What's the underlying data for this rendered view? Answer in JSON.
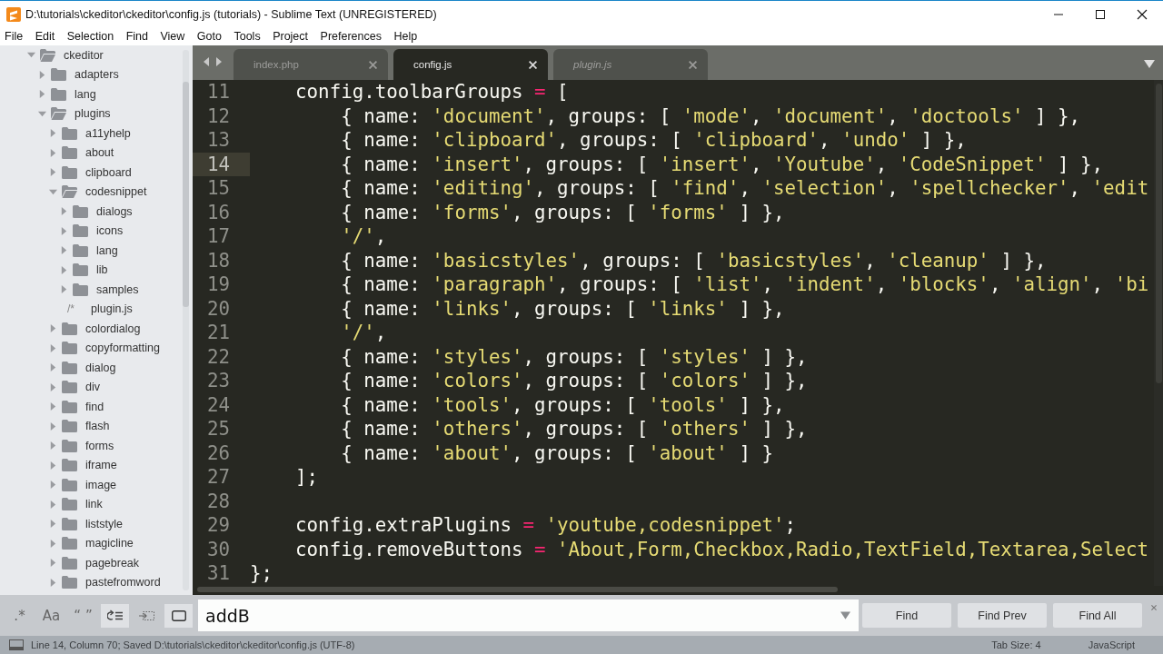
{
  "window": {
    "title": "D:\\tutorials\\ckeditor\\ckeditor\\config.js (tutorials) - Sublime Text (UNREGISTERED)"
  },
  "menu": [
    "File",
    "Edit",
    "Selection",
    "Find",
    "View",
    "Goto",
    "Tools",
    "Project",
    "Preferences",
    "Help"
  ],
  "sidebar": {
    "items": [
      {
        "kind": "folder",
        "name": "ckeditor",
        "expanded": true,
        "children": [
          {
            "kind": "folder",
            "name": "adapters",
            "expanded": false
          },
          {
            "kind": "folder",
            "name": "lang",
            "expanded": false
          },
          {
            "kind": "folder",
            "name": "plugins",
            "expanded": true,
            "children": [
              {
                "kind": "folder",
                "name": "a11yhelp",
                "expanded": false
              },
              {
                "kind": "folder",
                "name": "about",
                "expanded": false
              },
              {
                "kind": "folder",
                "name": "clipboard",
                "expanded": false
              },
              {
                "kind": "folder",
                "name": "codesnippet",
                "expanded": true,
                "children": [
                  {
                    "kind": "folder",
                    "name": "dialogs",
                    "expanded": false
                  },
                  {
                    "kind": "folder",
                    "name": "icons",
                    "expanded": false
                  },
                  {
                    "kind": "folder",
                    "name": "lang",
                    "expanded": false
                  },
                  {
                    "kind": "folder",
                    "name": "lib",
                    "expanded": false
                  },
                  {
                    "kind": "folder",
                    "name": "samples",
                    "expanded": false
                  },
                  {
                    "kind": "file",
                    "name": "plugin.js",
                    "glyph": "/*"
                  }
                ]
              },
              {
                "kind": "folder",
                "name": "colordialog",
                "expanded": false
              },
              {
                "kind": "folder",
                "name": "copyformatting",
                "expanded": false
              },
              {
                "kind": "folder",
                "name": "dialog",
                "expanded": false
              },
              {
                "kind": "folder",
                "name": "div",
                "expanded": false
              },
              {
                "kind": "folder",
                "name": "find",
                "expanded": false
              },
              {
                "kind": "folder",
                "name": "flash",
                "expanded": false
              },
              {
                "kind": "folder",
                "name": "forms",
                "expanded": false
              },
              {
                "kind": "folder",
                "name": "iframe",
                "expanded": false
              },
              {
                "kind": "folder",
                "name": "image",
                "expanded": false
              },
              {
                "kind": "folder",
                "name": "link",
                "expanded": false
              },
              {
                "kind": "folder",
                "name": "liststyle",
                "expanded": false
              },
              {
                "kind": "folder",
                "name": "magicline",
                "expanded": false
              },
              {
                "kind": "folder",
                "name": "pagebreak",
                "expanded": false
              },
              {
                "kind": "folder",
                "name": "pastefromword",
                "expanded": false
              }
            ]
          }
        ]
      }
    ]
  },
  "tabs": [
    {
      "label": "index.php",
      "selected": false,
      "preview": false
    },
    {
      "label": "config.js",
      "selected": true,
      "preview": false
    },
    {
      "label": "plugin.js",
      "selected": false,
      "preview": true
    }
  ],
  "editor": {
    "lines": [
      {
        "number": "11",
        "current": false,
        "tokens": [
          {
            "kind": "plain",
            "text": "    config.toolbarGroups "
          },
          {
            "kind": "operator",
            "text": "="
          },
          {
            "kind": "plain",
            "text": " ["
          }
        ]
      },
      {
        "number": "12",
        "current": false,
        "tokens": [
          {
            "kind": "plain",
            "text": "        { name: "
          },
          {
            "kind": "string",
            "text": "'document'"
          },
          {
            "kind": "plain",
            "text": ", groups: [ "
          },
          {
            "kind": "string",
            "text": "'mode'"
          },
          {
            "kind": "plain",
            "text": ", "
          },
          {
            "kind": "string",
            "text": "'document'"
          },
          {
            "kind": "plain",
            "text": ", "
          },
          {
            "kind": "string",
            "text": "'doctools'"
          },
          {
            "kind": "plain",
            "text": " ] },"
          }
        ]
      },
      {
        "number": "13",
        "current": false,
        "tokens": [
          {
            "kind": "plain",
            "text": "        { name: "
          },
          {
            "kind": "string",
            "text": "'clipboard'"
          },
          {
            "kind": "plain",
            "text": ", groups: [ "
          },
          {
            "kind": "string",
            "text": "'clipboard'"
          },
          {
            "kind": "plain",
            "text": ", "
          },
          {
            "kind": "string",
            "text": "'undo'"
          },
          {
            "kind": "plain",
            "text": " ] },"
          }
        ]
      },
      {
        "number": "14",
        "current": true,
        "tokens": [
          {
            "kind": "plain",
            "text": "        { name: "
          },
          {
            "kind": "string",
            "text": "'insert'"
          },
          {
            "kind": "plain",
            "text": ", groups: [ "
          },
          {
            "kind": "string",
            "text": "'insert'"
          },
          {
            "kind": "plain",
            "text": ", "
          },
          {
            "kind": "string",
            "text": "'Youtube'"
          },
          {
            "kind": "plain",
            "text": ", "
          },
          {
            "kind": "string",
            "text": "'CodeSnippet'"
          },
          {
            "kind": "plain",
            "text": " ] },"
          }
        ]
      },
      {
        "number": "15",
        "current": false,
        "tokens": [
          {
            "kind": "plain",
            "text": "        { name: "
          },
          {
            "kind": "string",
            "text": "'editing'"
          },
          {
            "kind": "plain",
            "text": ", groups: [ "
          },
          {
            "kind": "string",
            "text": "'find'"
          },
          {
            "kind": "plain",
            "text": ", "
          },
          {
            "kind": "string",
            "text": "'selection'"
          },
          {
            "kind": "plain",
            "text": ", "
          },
          {
            "kind": "string",
            "text": "'spellchecker'"
          },
          {
            "kind": "plain",
            "text": ", "
          },
          {
            "kind": "string",
            "text": "'edit"
          }
        ]
      },
      {
        "number": "16",
        "current": false,
        "tokens": [
          {
            "kind": "plain",
            "text": "        { name: "
          },
          {
            "kind": "string",
            "text": "'forms'"
          },
          {
            "kind": "plain",
            "text": ", groups: [ "
          },
          {
            "kind": "string",
            "text": "'forms'"
          },
          {
            "kind": "plain",
            "text": " ] },"
          }
        ]
      },
      {
        "number": "17",
        "current": false,
        "tokens": [
          {
            "kind": "string",
            "text": "        '/'"
          },
          {
            "kind": "plain",
            "text": ","
          }
        ]
      },
      {
        "number": "18",
        "current": false,
        "tokens": [
          {
            "kind": "plain",
            "text": "        { name: "
          },
          {
            "kind": "string",
            "text": "'basicstyles'"
          },
          {
            "kind": "plain",
            "text": ", groups: [ "
          },
          {
            "kind": "string",
            "text": "'basicstyles'"
          },
          {
            "kind": "plain",
            "text": ", "
          },
          {
            "kind": "string",
            "text": "'cleanup'"
          },
          {
            "kind": "plain",
            "text": " ] },"
          }
        ]
      },
      {
        "number": "19",
        "current": false,
        "tokens": [
          {
            "kind": "plain",
            "text": "        { name: "
          },
          {
            "kind": "string",
            "text": "'paragraph'"
          },
          {
            "kind": "plain",
            "text": ", groups: [ "
          },
          {
            "kind": "string",
            "text": "'list'"
          },
          {
            "kind": "plain",
            "text": ", "
          },
          {
            "kind": "string",
            "text": "'indent'"
          },
          {
            "kind": "plain",
            "text": ", "
          },
          {
            "kind": "string",
            "text": "'blocks'"
          },
          {
            "kind": "plain",
            "text": ", "
          },
          {
            "kind": "string",
            "text": "'align'"
          },
          {
            "kind": "plain",
            "text": ", "
          },
          {
            "kind": "string",
            "text": "'bi"
          }
        ]
      },
      {
        "number": "20",
        "current": false,
        "tokens": [
          {
            "kind": "plain",
            "text": "        { name: "
          },
          {
            "kind": "string",
            "text": "'links'"
          },
          {
            "kind": "plain",
            "text": ", groups: [ "
          },
          {
            "kind": "string",
            "text": "'links'"
          },
          {
            "kind": "plain",
            "text": " ] },"
          }
        ]
      },
      {
        "number": "21",
        "current": false,
        "tokens": [
          {
            "kind": "string",
            "text": "        '/'"
          },
          {
            "kind": "plain",
            "text": ","
          }
        ]
      },
      {
        "number": "22",
        "current": false,
        "tokens": [
          {
            "kind": "plain",
            "text": "        { name: "
          },
          {
            "kind": "string",
            "text": "'styles'"
          },
          {
            "kind": "plain",
            "text": ", groups: [ "
          },
          {
            "kind": "string",
            "text": "'styles'"
          },
          {
            "kind": "plain",
            "text": " ] },"
          }
        ]
      },
      {
        "number": "23",
        "current": false,
        "tokens": [
          {
            "kind": "plain",
            "text": "        { name: "
          },
          {
            "kind": "string",
            "text": "'colors'"
          },
          {
            "kind": "plain",
            "text": ", groups: [ "
          },
          {
            "kind": "string",
            "text": "'colors'"
          },
          {
            "kind": "plain",
            "text": " ] },"
          }
        ]
      },
      {
        "number": "24",
        "current": false,
        "tokens": [
          {
            "kind": "plain",
            "text": "        { name: "
          },
          {
            "kind": "string",
            "text": "'tools'"
          },
          {
            "kind": "plain",
            "text": ", groups: [ "
          },
          {
            "kind": "string",
            "text": "'tools'"
          },
          {
            "kind": "plain",
            "text": " ] },"
          }
        ]
      },
      {
        "number": "25",
        "current": false,
        "tokens": [
          {
            "kind": "plain",
            "text": "        { name: "
          },
          {
            "kind": "string",
            "text": "'others'"
          },
          {
            "kind": "plain",
            "text": ", groups: [ "
          },
          {
            "kind": "string",
            "text": "'others'"
          },
          {
            "kind": "plain",
            "text": " ] },"
          }
        ]
      },
      {
        "number": "26",
        "current": false,
        "tokens": [
          {
            "kind": "plain",
            "text": "        { name: "
          },
          {
            "kind": "string",
            "text": "'about'"
          },
          {
            "kind": "plain",
            "text": ", groups: [ "
          },
          {
            "kind": "string",
            "text": "'about'"
          },
          {
            "kind": "plain",
            "text": " ] }"
          }
        ]
      },
      {
        "number": "27",
        "current": false,
        "tokens": [
          {
            "kind": "plain",
            "text": "    ];"
          }
        ]
      },
      {
        "number": "28",
        "current": false
      },
      {
        "number": "29",
        "current": false,
        "tokens": [
          {
            "kind": "plain",
            "text": "    config.extraPlugins"
          },
          {
            "kind": "operator",
            "text": " = "
          },
          {
            "kind": "string",
            "text": "'youtube,codesnippet'"
          },
          {
            "kind": "plain",
            "text": ";"
          }
        ]
      },
      {
        "number": "30",
        "current": false,
        "tokens": [
          {
            "kind": "plain",
            "text": "    config.removeButtons"
          },
          {
            "kind": "operator",
            "text": " = "
          },
          {
            "kind": "string",
            "text": "'About,Form,Checkbox,Radio,TextField,Textarea,Select"
          }
        ]
      },
      {
        "number": "31",
        "current": false,
        "tokens": [
          {
            "kind": "plain",
            "text": "};"
          }
        ]
      }
    ]
  },
  "find_panel": {
    "toggles": [
      {
        "kind": "text",
        "label": ".*",
        "on": false
      },
      {
        "kind": "text",
        "label": "Aa",
        "on": false
      },
      {
        "kind": "text",
        "label": "“ ”",
        "on": false
      },
      {
        "kind": "wrap",
        "on": true
      },
      {
        "kind": "selection",
        "on": false
      },
      {
        "kind": "highlight",
        "on": true
      }
    ],
    "value": "addB",
    "buttons": [
      "Find",
      "Find Prev",
      "Find All"
    ]
  },
  "status_bar": {
    "message": "Line 14, Column 70; Saved D:\\tutorials\\ckeditor\\ckeditor\\config.js (UTF-8)",
    "tab_size": "Tab Size: 4",
    "syntax": "JavaScript"
  }
}
